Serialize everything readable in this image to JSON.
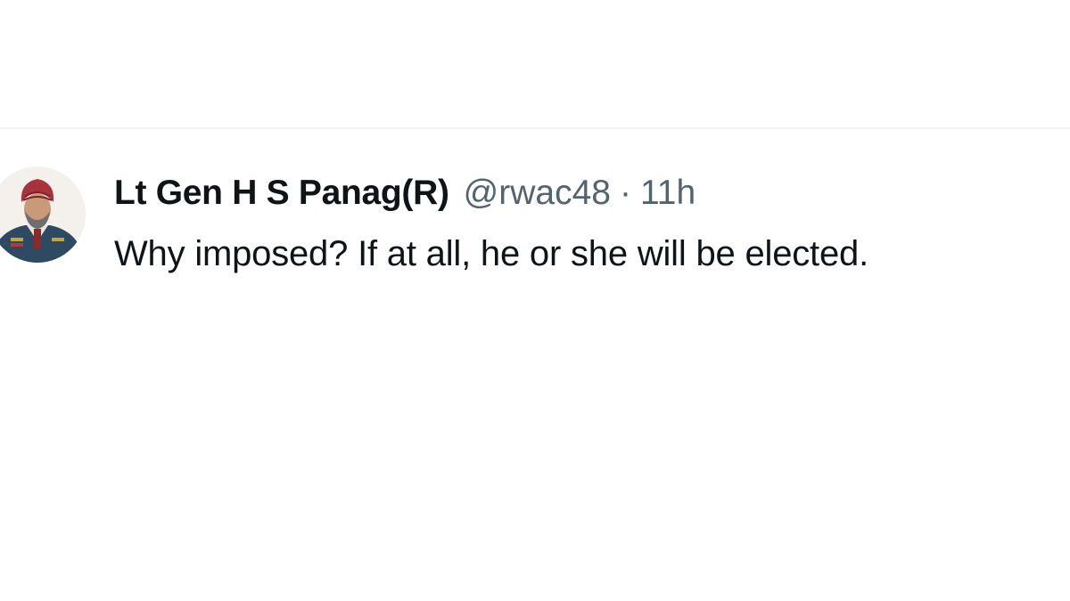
{
  "tweet": {
    "author_name": "Lt Gen H S Panag(R)",
    "handle": "@rwac48",
    "separator": "·",
    "timestamp": "11h",
    "text": "Why imposed? If at all, he or she will be elected.",
    "avatar": {
      "icon": "user-avatar-photo"
    }
  },
  "colors": {
    "text_primary": "#0f1419",
    "text_secondary": "#536471",
    "divider": "#eff3f4",
    "background": "#ffffff"
  }
}
